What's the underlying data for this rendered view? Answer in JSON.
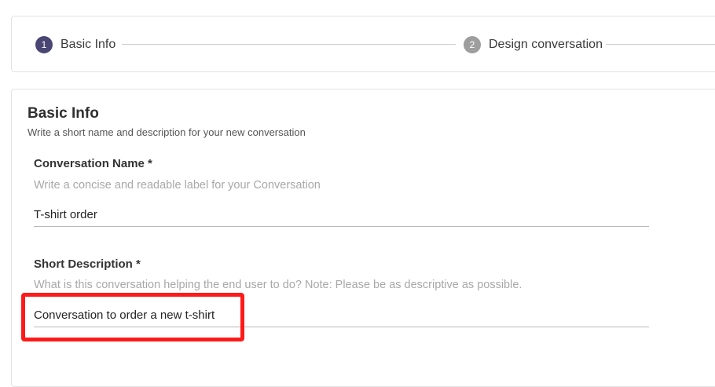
{
  "stepper": {
    "steps": [
      {
        "number": "1",
        "label": "Basic Info",
        "active": true
      },
      {
        "number": "2",
        "label": "Design conversation",
        "active": false
      }
    ]
  },
  "form": {
    "title": "Basic Info",
    "subtitle": "Write a short name and description for your new conversation",
    "fields": {
      "name": {
        "label": "Conversation Name *",
        "help": "Write a concise and readable label for your Conversation",
        "value": "T-shirt order"
      },
      "description": {
        "label": "Short Description *",
        "help": "What is this conversation helping the end user to do? Note: Please be as descriptive as possible.",
        "value": "Conversation to order a new t-shirt"
      }
    }
  },
  "colors": {
    "step_active": "#4a4673",
    "step_inactive": "#9e9e9e",
    "highlight": "#ff1a1a"
  }
}
